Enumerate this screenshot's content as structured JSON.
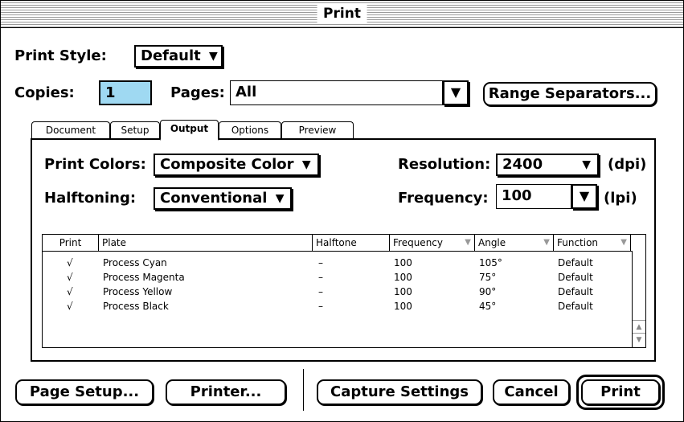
{
  "window": {
    "title": "Print"
  },
  "print_style": {
    "label": "Print Style:",
    "value": "Default"
  },
  "copies": {
    "label": "Copies:",
    "value": "1"
  },
  "pages": {
    "label": "Pages:",
    "value": "All"
  },
  "range_button": "Range Separators...",
  "tabs": [
    {
      "label": "Document"
    },
    {
      "label": "Setup"
    },
    {
      "label": "Output"
    },
    {
      "label": "Options"
    },
    {
      "label": "Preview"
    }
  ],
  "active_tab": "Output",
  "print_colors": {
    "label": "Print Colors:",
    "value": "Composite Color"
  },
  "halftoning": {
    "label": "Halftoning:",
    "value": "Conventional"
  },
  "resolution": {
    "label": "Resolution:",
    "value": "2400",
    "unit": "(dpi)"
  },
  "frequency": {
    "label": "Frequency:",
    "value": "100",
    "unit": "(lpi)"
  },
  "plates_table": {
    "columns": [
      "Print",
      "Plate",
      "Halftone",
      "Frequency",
      "Angle",
      "Function"
    ],
    "rows": [
      {
        "print": "√",
        "plate": "Process Cyan",
        "halftone": "–",
        "frequency": "100",
        "angle": "105°",
        "function": "Default"
      },
      {
        "print": "√",
        "plate": "Process Magenta",
        "halftone": "–",
        "frequency": "100",
        "angle": "75°",
        "function": "Default"
      },
      {
        "print": "√",
        "plate": "Process Yellow",
        "halftone": "–",
        "frequency": "100",
        "angle": "90°",
        "function": "Default"
      },
      {
        "print": "√",
        "plate": "Process Black",
        "halftone": "–",
        "frequency": "100",
        "angle": "45°",
        "function": "Default"
      }
    ]
  },
  "buttons": {
    "page_setup": "Page Setup...",
    "printer": "Printer...",
    "capture_settings": "Capture Settings",
    "cancel": "Cancel",
    "print": "Print"
  },
  "icons": {
    "dropdown": "▼",
    "scroll_up": "▲",
    "scroll_down": "▼"
  },
  "colors": {
    "copies_highlight": "#9fd9f2"
  }
}
